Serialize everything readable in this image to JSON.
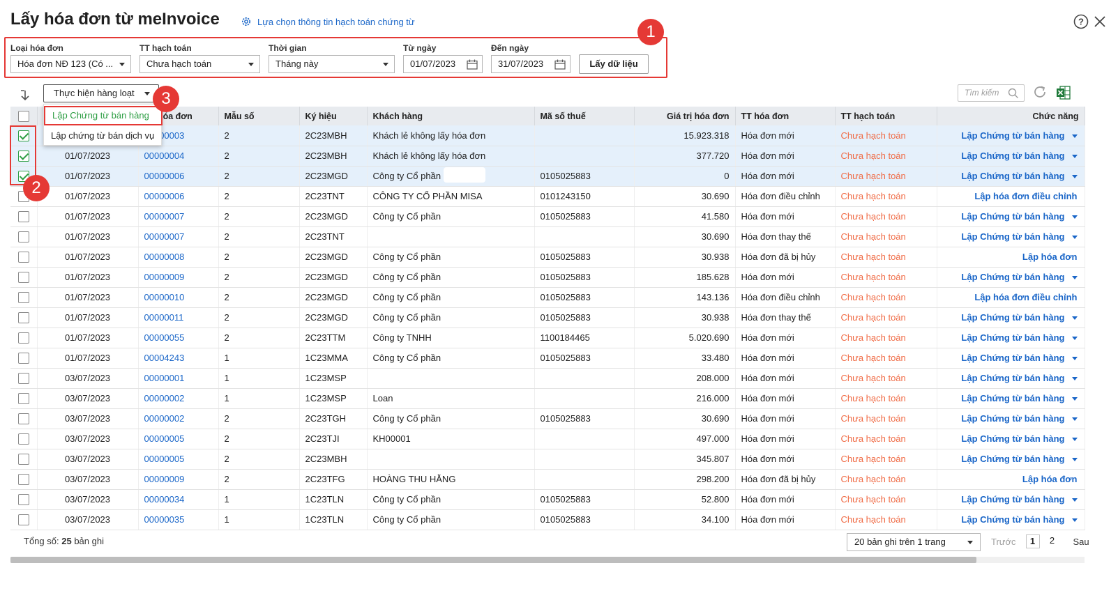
{
  "header": {
    "title": "Lấy hóa đơn từ meInvoice",
    "setting_link": "Lựa chọn thông tin hạch toán chứng từ",
    "help_icon": "help-icon",
    "close_icon": "close-icon"
  },
  "filters": {
    "invoice_type_label": "Loại hóa đơn",
    "invoice_type_value": "Hóa đơn NĐ 123 (Có ...",
    "accounting_status_label": "TT hạch toán",
    "accounting_status_value": "Chưa hạch toán",
    "time_label": "Thời gian",
    "time_value": "Tháng này",
    "from_date_label": "Từ ngày",
    "from_date_value": "01/07/2023",
    "to_date_label": "Đến ngày",
    "to_date_value": "31/07/2023",
    "fetch_button": "Lấy dữ liệu"
  },
  "badges": {
    "one": "1",
    "two": "2",
    "three": "3"
  },
  "toolbar": {
    "bulk_action": "Thực hiện hàng loạt",
    "search_placeholder": "Tìm kiếm"
  },
  "bulk_menu": {
    "item_sales": "Lập Chứng từ bán hàng",
    "item_service": "Lập chứng từ bán dịch vụ"
  },
  "columns": {
    "invoice_no": "Số hóa đơn",
    "template": "Mẫu số",
    "symbol": "Ký hiệu",
    "customer": "Khách hàng",
    "tax_code": "Mã số thuế",
    "value": "Giá trị hóa đơn",
    "invoice_status": "TT hóa đơn",
    "accounting_status": "TT hạch toán",
    "function": "Chức năng"
  },
  "rows": [
    {
      "date": "",
      "no": "00000003",
      "tpl": "2",
      "sym": "2C23MBH",
      "cust": "Khách lẻ không lấy hóa đơn",
      "tax": "",
      "val": "15.923.318",
      "ist": "Hóa đơn mới",
      "ast": "Chưa hạch toán",
      "fn": "Lập Chứng từ bán hàng",
      "dd": true,
      "checked": true
    },
    {
      "date": "01/07/2023",
      "no": "00000004",
      "tpl": "2",
      "sym": "2C23MBH",
      "cust": "Khách lẻ không lấy hóa đơn",
      "tax": "",
      "val": "377.720",
      "ist": "Hóa đơn mới",
      "ast": "Chưa hạch toán",
      "fn": "Lập Chứng từ bán hàng",
      "dd": true,
      "checked": true
    },
    {
      "date": "01/07/2023",
      "no": "00000006",
      "tpl": "2",
      "sym": "2C23MGD",
      "cust": "Công ty Cổ phần",
      "tax": "0105025883",
      "val": "0",
      "ist": "Hóa đơn mới",
      "ast": "Chưa hạch toán",
      "fn": "Lập Chứng từ bán hàng",
      "dd": true,
      "checked": true
    },
    {
      "date": "01/07/2023",
      "no": "00000006",
      "tpl": "2",
      "sym": "2C23TNT",
      "cust": "CÔNG TY CỔ PHẦN MISA",
      "tax": "0101243150",
      "val": "30.690",
      "ist": "Hóa đơn điều chỉnh",
      "ast": "Chưa hạch toán",
      "fn": "Lập hóa đơn điều chỉnh",
      "dd": false,
      "checked": false
    },
    {
      "date": "01/07/2023",
      "no": "00000007",
      "tpl": "2",
      "sym": "2C23MGD",
      "cust": "Công ty Cổ phần",
      "tax": "0105025883",
      "val": "41.580",
      "ist": "Hóa đơn mới",
      "ast": "Chưa hạch toán",
      "fn": "Lập Chứng từ bán hàng",
      "dd": true,
      "checked": false
    },
    {
      "date": "01/07/2023",
      "no": "00000007",
      "tpl": "2",
      "sym": "2C23TNT",
      "cust": "",
      "tax": "",
      "val": "30.690",
      "ist": "Hóa đơn thay thế",
      "ast": "Chưa hạch toán",
      "fn": "Lập Chứng từ bán hàng",
      "dd": true,
      "checked": false
    },
    {
      "date": "01/07/2023",
      "no": "00000008",
      "tpl": "2",
      "sym": "2C23MGD",
      "cust": "Công ty Cổ phần",
      "tax": "0105025883",
      "val": "30.938",
      "ist": "Hóa đơn đã bị hủy",
      "ast": "Chưa hạch toán",
      "fn": "Lập hóa đơn",
      "dd": false,
      "checked": false
    },
    {
      "date": "01/07/2023",
      "no": "00000009",
      "tpl": "2",
      "sym": "2C23MGD",
      "cust": "Công ty Cổ phần",
      "tax": "0105025883",
      "val": "185.628",
      "ist": "Hóa đơn mới",
      "ast": "Chưa hạch toán",
      "fn": "Lập Chứng từ bán hàng",
      "dd": true,
      "checked": false
    },
    {
      "date": "01/07/2023",
      "no": "00000010",
      "tpl": "2",
      "sym": "2C23MGD",
      "cust": "Công ty Cổ phần",
      "tax": "0105025883",
      "val": "143.136",
      "ist": "Hóa đơn điều chỉnh",
      "ast": "Chưa hạch toán",
      "fn": "Lập hóa đơn điều chỉnh",
      "dd": false,
      "checked": false
    },
    {
      "date": "01/07/2023",
      "no": "00000011",
      "tpl": "2",
      "sym": "2C23MGD",
      "cust": "Công ty Cổ phần",
      "tax": "0105025883",
      "val": "30.938",
      "ist": "Hóa đơn thay thế",
      "ast": "Chưa hạch toán",
      "fn": "Lập Chứng từ bán hàng",
      "dd": true,
      "checked": false
    },
    {
      "date": "01/07/2023",
      "no": "00000055",
      "tpl": "2",
      "sym": "2C23TTM",
      "cust": "Công ty TNHH",
      "tax": "1100184465",
      "val": "5.020.690",
      "ist": "Hóa đơn mới",
      "ast": "Chưa hạch toán",
      "fn": "Lập Chứng từ bán hàng",
      "dd": true,
      "checked": false
    },
    {
      "date": "01/07/2023",
      "no": "00004243",
      "tpl": "1",
      "sym": "1C23MMA",
      "cust": "Công ty Cổ phần",
      "tax": "0105025883",
      "val": "33.480",
      "ist": "Hóa đơn mới",
      "ast": "Chưa hạch toán",
      "fn": "Lập Chứng từ bán hàng",
      "dd": true,
      "checked": false
    },
    {
      "date": "03/07/2023",
      "no": "00000001",
      "tpl": "1",
      "sym": "1C23MSP",
      "cust": "",
      "tax": "",
      "val": "208.000",
      "ist": "Hóa đơn mới",
      "ast": "Chưa hạch toán",
      "fn": "Lập Chứng từ bán hàng",
      "dd": true,
      "checked": false
    },
    {
      "date": "03/07/2023",
      "no": "00000002",
      "tpl": "1",
      "sym": "1C23MSP",
      "cust": "Loan",
      "tax": "",
      "val": "216.000",
      "ist": "Hóa đơn mới",
      "ast": "Chưa hạch toán",
      "fn": "Lập Chứng từ bán hàng",
      "dd": true,
      "checked": false
    },
    {
      "date": "03/07/2023",
      "no": "00000002",
      "tpl": "2",
      "sym": "2C23TGH",
      "cust": "Công ty Cổ phần",
      "tax": "0105025883",
      "val": "30.690",
      "ist": "Hóa đơn mới",
      "ast": "Chưa hạch toán",
      "fn": "Lập Chứng từ bán hàng",
      "dd": true,
      "checked": false
    },
    {
      "date": "03/07/2023",
      "no": "00000005",
      "tpl": "2",
      "sym": "2C23TJI",
      "cust": "KH00001",
      "tax": "",
      "val": "497.000",
      "ist": "Hóa đơn mới",
      "ast": "Chưa hạch toán",
      "fn": "Lập Chứng từ bán hàng",
      "dd": true,
      "checked": false
    },
    {
      "date": "03/07/2023",
      "no": "00000005",
      "tpl": "2",
      "sym": "2C23MBH",
      "cust": "",
      "tax": "",
      "val": "345.807",
      "ist": "Hóa đơn mới",
      "ast": "Chưa hạch toán",
      "fn": "Lập Chứng từ bán hàng",
      "dd": true,
      "checked": false
    },
    {
      "date": "03/07/2023",
      "no": "00000009",
      "tpl": "2",
      "sym": "2C23TFG",
      "cust": "HOÀNG THU HẰNG",
      "tax": "",
      "val": "298.200",
      "ist": "Hóa đơn đã bị hủy",
      "ast": "Chưa hạch toán",
      "fn": "Lập hóa đơn",
      "dd": false,
      "checked": false
    },
    {
      "date": "03/07/2023",
      "no": "00000034",
      "tpl": "1",
      "sym": "1C23TLN",
      "cust": "Công ty Cổ phần",
      "tax": "0105025883",
      "val": "52.800",
      "ist": "Hóa đơn mới",
      "ast": "Chưa hạch toán",
      "fn": "Lập Chứng từ bán hàng",
      "dd": true,
      "checked": false
    },
    {
      "date": "03/07/2023",
      "no": "00000035",
      "tpl": "1",
      "sym": "1C23TLN",
      "cust": "Công ty Cổ phần",
      "tax": "0105025883",
      "val": "34.100",
      "ist": "Hóa đơn mới",
      "ast": "Chưa hạch toán",
      "fn": "Lập Chứng từ bán hàng",
      "dd": true,
      "checked": false
    }
  ],
  "footer": {
    "total_label": "Tổng số:",
    "total_count": "25",
    "total_unit": "bản ghi",
    "page_size": "20 bản ghi trên 1 trang",
    "prev": "Trước",
    "page1": "1",
    "page2": "2",
    "next": "Sau"
  },
  "colors": {
    "accent": "#1a66c8",
    "warning": "#f06b45",
    "highlight": "#e53935",
    "check": "#2e9e44"
  }
}
